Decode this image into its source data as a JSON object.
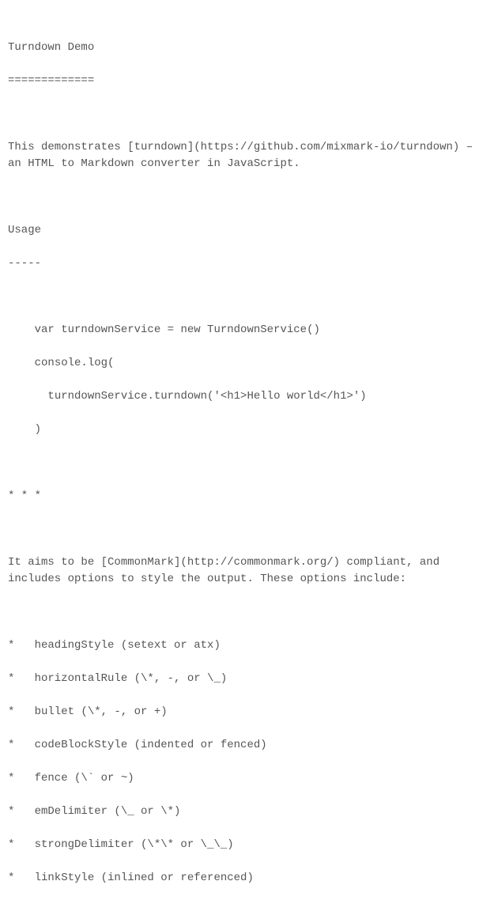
{
  "title": "Turndown Demo",
  "titleUnderline": "=============",
  "intro": "This demonstrates [turndown](https://github.com/mixmark-io/turndown) – an HTML to Markdown converter in JavaScript.",
  "usageHeading": "Usage",
  "usageUnderline": "-----",
  "code": {
    "l1": "    var turndownService = new TurndownService()",
    "l2": "    console.log(",
    "l3": "      turndownService.turndown('<h1>Hello world</h1>')",
    "l4": "    )"
  },
  "rule": "* * *",
  "aim": "It aims to be [CommonMark](http://commonmark.org/) compliant, and includes options to style the output. These options include:",
  "options": {
    "o1": "*   headingStyle (setext or atx)",
    "o2": "*   horizontalRule (\\*, -, or \\_)",
    "o3": "*   bullet (\\*, -, or +)",
    "o4": "*   codeBlockStyle (indented or fenced)",
    "o5": "*   fence (\\` or ~)",
    "o6": "*   emDelimiter (\\_ or \\*)",
    "o7": "*   strongDelimiter (\\*\\* or \\_\\_)",
    "o8": "*   linkStyle (inlined or referenced)"
  }
}
